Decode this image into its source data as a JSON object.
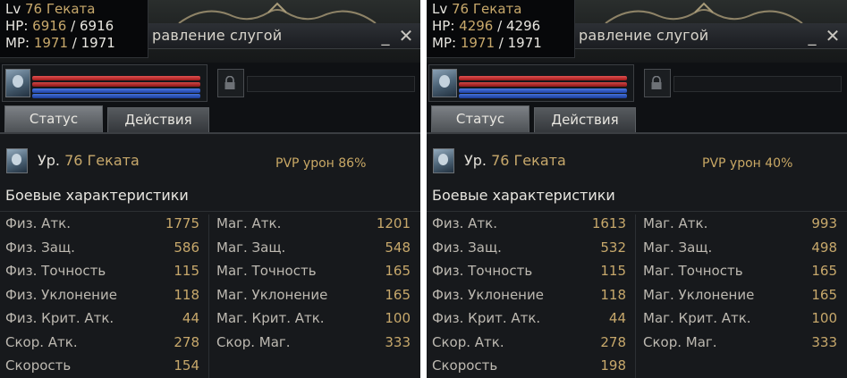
{
  "panels": [
    {
      "tooltip": {
        "lv_label": "Lv",
        "lv": "76",
        "name": "Геката",
        "hp_label": "HP:",
        "hp_cur": "6916",
        "hp_max": "6916",
        "mp_label": "MP:",
        "mp_cur": "1971",
        "mp_max": "1971"
      },
      "window_title": "равление слугой",
      "minimize": "_",
      "close": "✕",
      "tabs": [
        "Статус",
        "Действия"
      ],
      "pet_level_label": "Ур.",
      "pet_level": "76",
      "pet_name": "Геката",
      "pvp": "PVP урон 86%",
      "section": "Боевые характеристики",
      "left_stats": [
        {
          "label": "Физ. Атк.",
          "value": "1775"
        },
        {
          "label": "Физ. Защ.",
          "value": "586"
        },
        {
          "label": "Физ. Точность",
          "value": "115"
        },
        {
          "label": "Физ. Уклонение",
          "value": "118"
        },
        {
          "label": "Физ. Крит. Атк.",
          "value": "44"
        },
        {
          "label": "Скор. Атк.",
          "value": "278"
        },
        {
          "label": "Скорость",
          "value": "154"
        }
      ],
      "right_stats": [
        {
          "label": "Маг. Атк.",
          "value": "1201"
        },
        {
          "label": "Маг. Защ.",
          "value": "548"
        },
        {
          "label": "Маг. Точность",
          "value": "165"
        },
        {
          "label": "Маг. Уклонение",
          "value": "165"
        },
        {
          "label": "Маг. Крит. Атк.",
          "value": "100"
        },
        {
          "label": "Скор. Маг.",
          "value": "333"
        }
      ]
    },
    {
      "tooltip": {
        "lv_label": "Lv",
        "lv": "76",
        "name": "Геката",
        "hp_label": "HP:",
        "hp_cur": "4296",
        "hp_max": "4296",
        "mp_label": "MP:",
        "mp_cur": "1971",
        "mp_max": "1971"
      },
      "window_title": "равление слугой",
      "minimize": "_",
      "close": "✕",
      "tabs": [
        "Статус",
        "Действия"
      ],
      "pet_level_label": "Ур.",
      "pet_level": "76",
      "pet_name": "Геката",
      "pvp": "PVP урон 40%",
      "section": "Боевые характеристики",
      "left_stats": [
        {
          "label": "Физ. Атк.",
          "value": "1613"
        },
        {
          "label": "Физ. Защ.",
          "value": "532"
        },
        {
          "label": "Физ. Точность",
          "value": "115"
        },
        {
          "label": "Физ. Уклонение",
          "value": "118"
        },
        {
          "label": "Физ. Крит. Атк.",
          "value": "44"
        },
        {
          "label": "Скор. Атк.",
          "value": "278"
        },
        {
          "label": "Скорость",
          "value": "198"
        }
      ],
      "right_stats": [
        {
          "label": "Маг. Атк.",
          "value": "993"
        },
        {
          "label": "Маг. Защ.",
          "value": "498"
        },
        {
          "label": "Маг. Точность",
          "value": "165"
        },
        {
          "label": "Маг. Уклонение",
          "value": "165"
        },
        {
          "label": "Маг. Крит. Атк.",
          "value": "100"
        },
        {
          "label": "Скор. Маг.",
          "value": "333"
        }
      ]
    }
  ],
  "colors": {
    "gold": "#c7a86b",
    "hp": "#c83232",
    "mp": "#2f56c2",
    "text": "#e8e6e0"
  },
  "icons": {
    "pet": "pet-portrait-icon",
    "lock": "lock-icon",
    "close": "close-icon",
    "minimize": "minimize-icon"
  }
}
